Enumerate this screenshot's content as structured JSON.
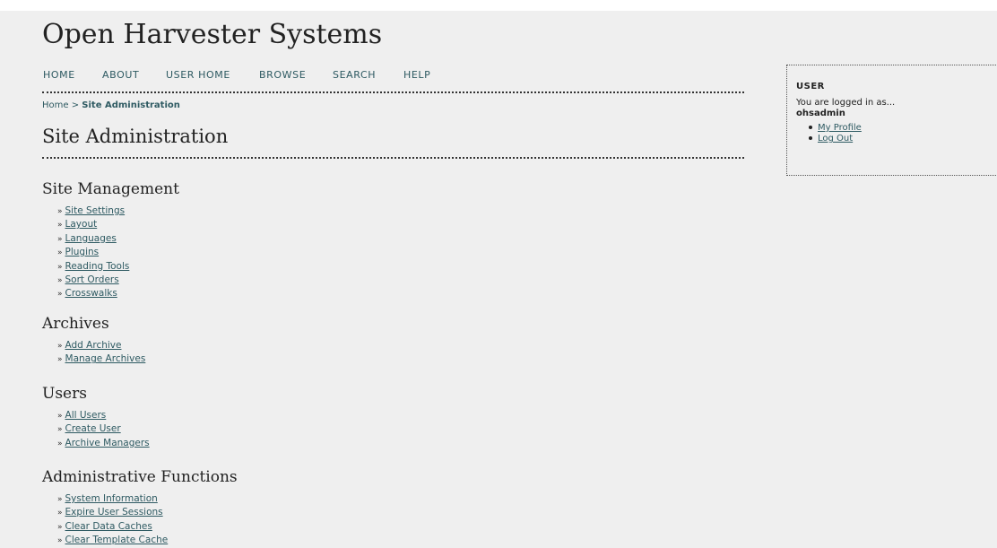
{
  "site_title": "Open Harvester Systems",
  "nav": {
    "items": [
      {
        "label": "HOME"
      },
      {
        "label": "ABOUT"
      },
      {
        "label": "USER HOME"
      },
      {
        "label": "BROWSE"
      },
      {
        "label": "SEARCH"
      },
      {
        "label": "HELP"
      }
    ]
  },
  "breadcrumb": {
    "home": "Home",
    "separator": ">",
    "current": "Site Administration"
  },
  "page_title": "Site Administration",
  "sections": [
    {
      "heading": "Site Management",
      "links": [
        "Site Settings",
        "Layout",
        "Languages",
        "Plugins",
        "Reading Tools",
        "Sort Orders",
        "Crosswalks"
      ]
    },
    {
      "heading": "Archives",
      "links": [
        "Add Archive",
        "Manage Archives"
      ]
    },
    {
      "heading": "Users",
      "links": [
        "All Users",
        "Create User",
        "Archive Managers"
      ]
    },
    {
      "heading": "Administrative Functions",
      "links": [
        "System Information",
        "Expire User Sessions",
        "Clear Data Caches",
        "Clear Template Cache"
      ]
    }
  ],
  "sidebar": {
    "title": "USER",
    "logged_in_text": "You are logged in as...",
    "username": "ohsadmin",
    "links": [
      "My Profile",
      "Log Out"
    ]
  },
  "link_marker": "»",
  "colors": {
    "page_background": "#efefef",
    "link": "#2e5a62",
    "heading_text": "#222222"
  }
}
